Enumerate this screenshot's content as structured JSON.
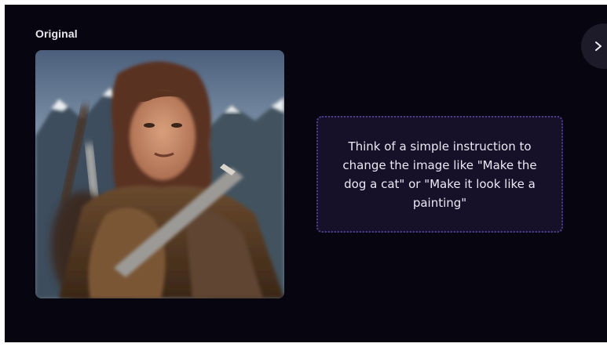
{
  "section": {
    "label": "Original"
  },
  "image": {
    "subject": "portrait of a long-haired man in fur armor with snowy mountains behind"
  },
  "hint": {
    "text": "Think of a simple instruction to change the image like \"Make the dog a cat\" or \"Make it look like a painting\""
  },
  "nav": {
    "next_icon": "chevron-right-icon"
  },
  "colors": {
    "background": "#07050f",
    "hint_background": "#161129",
    "hint_border": "#4d3c93",
    "next_button": "#1d1a29"
  }
}
